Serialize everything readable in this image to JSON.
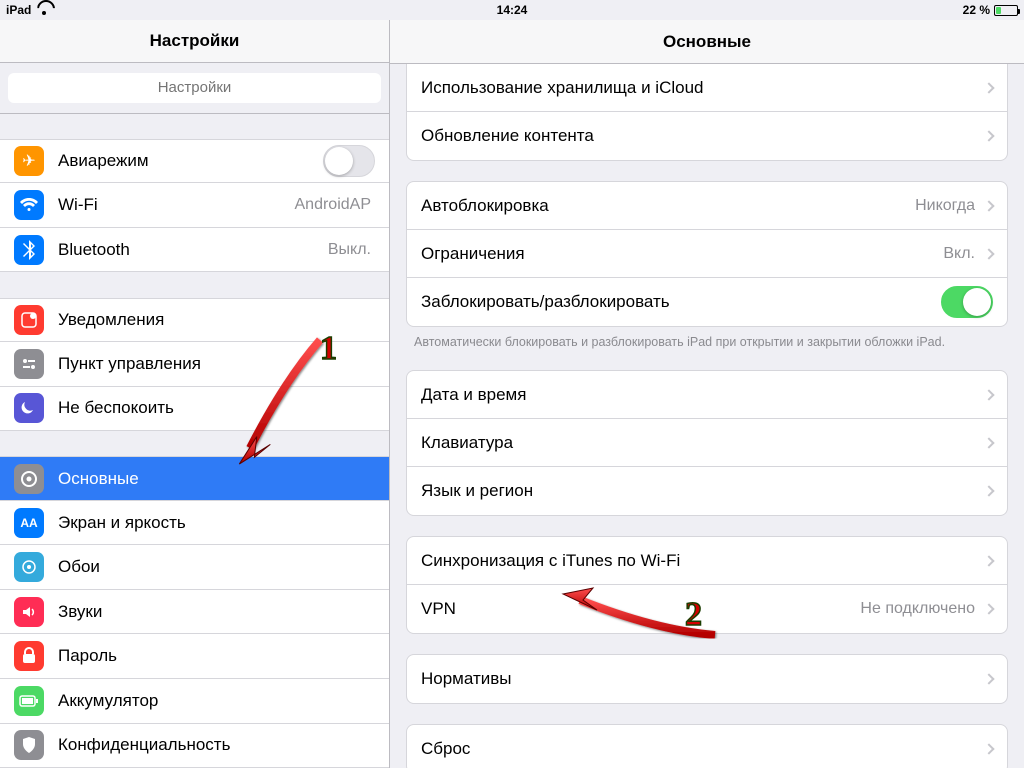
{
  "status": {
    "device": "iPad",
    "time": "14:24",
    "battery_pct": "22 %"
  },
  "sidebar": {
    "title": "Настройки",
    "search_placeholder": "Настройки",
    "items": {
      "airplane": "Авиарежим",
      "wifi": {
        "label": "Wi-Fi",
        "value": "AndroidAP"
      },
      "bluetooth": {
        "label": "Bluetooth",
        "value": "Выкл."
      },
      "notifications": "Уведомления",
      "control_center": "Пункт управления",
      "dnd": "Не беспокоить",
      "general": "Основные",
      "display": "Экран и яркость",
      "wallpaper": "Обои",
      "sounds": "Звуки",
      "passcode": "Пароль",
      "battery": "Аккумулятор",
      "privacy": "Конфиденциальность"
    }
  },
  "detail": {
    "title": "Основные",
    "rows": {
      "storage": "Использование хранилища и iCloud",
      "refresh": "Обновление контента",
      "autolock": {
        "label": "Автоблокировка",
        "value": "Никогда"
      },
      "restrictions": {
        "label": "Ограничения",
        "value": "Вкл."
      },
      "lockunlock": "Заблокировать/разблокировать",
      "datetime": "Дата и время",
      "keyboard": "Клавиатура",
      "language": "Язык и регион",
      "itunes": "Синхронизация с iTunes по Wi-Fi",
      "vpn": {
        "label": "VPN",
        "value": "Не подключено"
      },
      "regulatory": "Нормативы",
      "reset": "Сброс"
    },
    "footer": "Автоматически блокировать и разблокировать iPad при открытии и закрытии обложки iPad."
  },
  "annotations": {
    "one": "1",
    "two": "2"
  }
}
